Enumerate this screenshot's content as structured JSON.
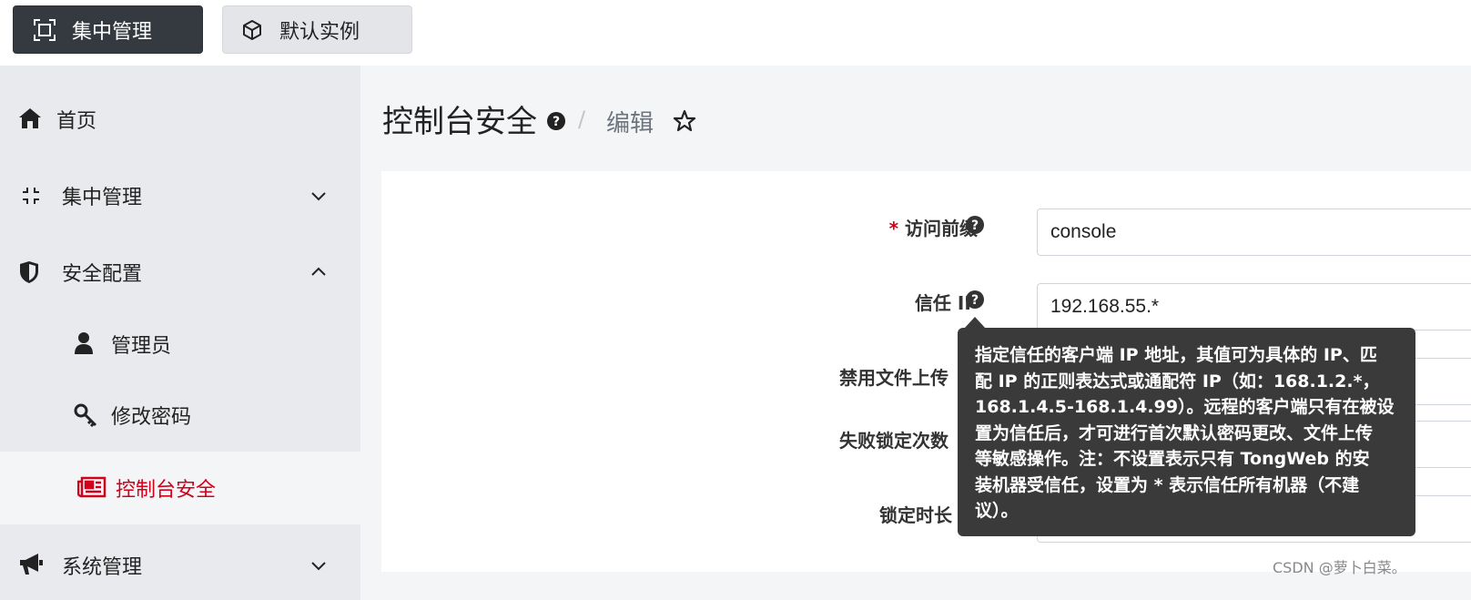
{
  "topbar": {
    "central_button": {
      "label": "集中管理",
      "icon": "frame-icon"
    },
    "instance_button": {
      "label": "默认实例",
      "icon": "cube-icon"
    }
  },
  "sidebar": {
    "items": [
      {
        "label": "首页",
        "icon": "home-icon"
      },
      {
        "label": "集中管理",
        "icon": "compress-icon",
        "chevron": "down"
      },
      {
        "label": "安全配置",
        "icon": "shield-icon",
        "chevron": "up"
      },
      {
        "label": "管理员",
        "icon": "user-icon"
      },
      {
        "label": "修改密码",
        "icon": "key-icon"
      },
      {
        "label": "控制台安全",
        "icon": "newspaper-icon",
        "active": true
      },
      {
        "label": "系统管理",
        "icon": "bullhorn-icon",
        "chevron": "down"
      }
    ]
  },
  "page": {
    "title": "控制台安全",
    "separator": "/",
    "crumb": "编辑"
  },
  "form": {
    "fields": [
      {
        "label": "访问前缀",
        "required_mark": "*",
        "value": "console"
      },
      {
        "label": "信任 IP",
        "value": "192.168.55.*"
      },
      {
        "label": "禁用文件上传"
      },
      {
        "label": "失败锁定次数"
      },
      {
        "label": "锁定时长"
      }
    ]
  },
  "tooltip": {
    "text": "指定信任的客户端 IP 地址，其值可为具体的 IP、匹配 IP 的正则表达式或通配符 IP（如：168.1.2.*，168.1.4.5-168.1.4.99）。远程的客户端只有在被设置为信任后，才可进行首次默认密码更改、文件上传等敏感操作。注：不设置表示只有 TongWeb 的安装机器受信任，设置为 * 表示信任所有机器（不建议）。",
    "lines": [
      "指定信任的客户端 IP 地址，其值可为具体的 IP、匹",
      "配 IP 的正则表达式或通配符 IP（如：168.1.2.*，",
      "168.1.4.5-168.1.4.99）。远程的客户端只有在被设",
      "置为信任后，才可进行首次默认密码更改、文件上传",
      "等敏感操作。注：不设置表示只有 TongWeb 的安",
      "装机器受信任，设置为 * 表示信任所有机器（不建",
      "议）。"
    ]
  },
  "watermark": "CSDN @萝卜白菜。",
  "colors": {
    "accent_red": "#d0021b",
    "dark_button": "#343a40",
    "sidebar_bg": "#e9eaed",
    "tooltip_bg": "#3a3a3a"
  }
}
